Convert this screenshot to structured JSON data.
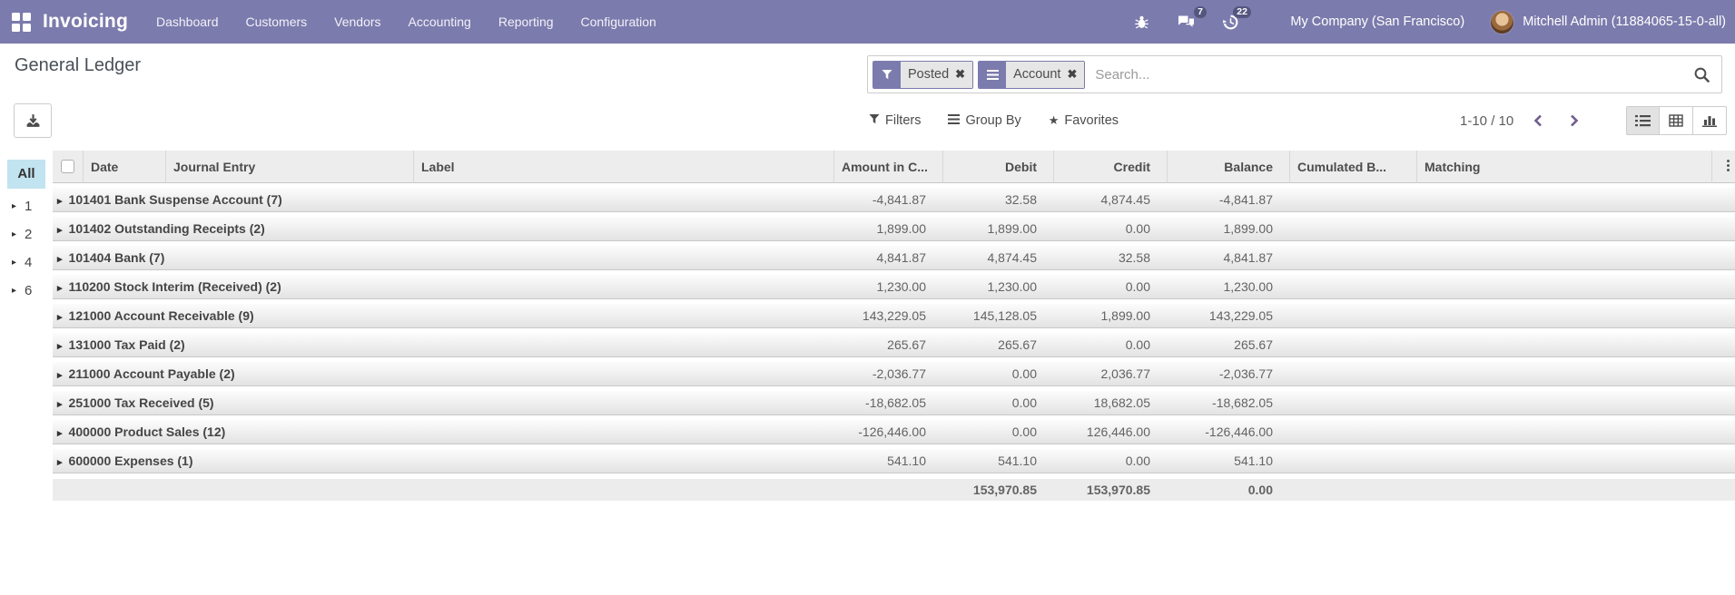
{
  "nav": {
    "app_name": "Invoicing",
    "menus": [
      "Dashboard",
      "Customers",
      "Vendors",
      "Accounting",
      "Reporting",
      "Configuration"
    ],
    "systray": {
      "messages_count": "7",
      "activities_count": "22",
      "company": "My Company (San Francisco)",
      "user": "Mitchell Admin (11884065-15-0-all)"
    }
  },
  "page": {
    "title": "General Ledger"
  },
  "search": {
    "facets": [
      {
        "icon": "filter-icon",
        "label": "Posted"
      },
      {
        "icon": "group-by-icon",
        "label": "Account"
      }
    ],
    "placeholder": "Search..."
  },
  "controls": {
    "filters": "Filters",
    "group_by": "Group By",
    "favorites": "Favorites",
    "pager": "1-10 / 10"
  },
  "sidebar": {
    "all_label": "All",
    "items": [
      "1",
      "2",
      "4",
      "6"
    ]
  },
  "table": {
    "headers": [
      "Date",
      "Journal Entry",
      "Label",
      "Amount in C...",
      "Debit",
      "Credit",
      "Balance",
      "Cumulated B...",
      "Matching"
    ],
    "groups": [
      {
        "name": "101401 Bank Suspense Account (7)",
        "amount_currency": "-4,841.87",
        "debit": "32.58",
        "credit": "4,874.45",
        "balance": "-4,841.87"
      },
      {
        "name": "101402 Outstanding Receipts (2)",
        "amount_currency": "1,899.00",
        "debit": "1,899.00",
        "credit": "0.00",
        "balance": "1,899.00"
      },
      {
        "name": "101404 Bank (7)",
        "amount_currency": "4,841.87",
        "debit": "4,874.45",
        "credit": "32.58",
        "balance": "4,841.87"
      },
      {
        "name": "110200 Stock Interim (Received) (2)",
        "amount_currency": "1,230.00",
        "debit": "1,230.00",
        "credit": "0.00",
        "balance": "1,230.00"
      },
      {
        "name": "121000 Account Receivable (9)",
        "amount_currency": "143,229.05",
        "debit": "145,128.05",
        "credit": "1,899.00",
        "balance": "143,229.05"
      },
      {
        "name": "131000 Tax Paid (2)",
        "amount_currency": "265.67",
        "debit": "265.67",
        "credit": "0.00",
        "balance": "265.67"
      },
      {
        "name": "211000 Account Payable (2)",
        "amount_currency": "-2,036.77",
        "debit": "0.00",
        "credit": "2,036.77",
        "balance": "-2,036.77"
      },
      {
        "name": "251000 Tax Received (5)",
        "amount_currency": "-18,682.05",
        "debit": "0.00",
        "credit": "18,682.05",
        "balance": "-18,682.05"
      },
      {
        "name": "400000 Product Sales (12)",
        "amount_currency": "-126,446.00",
        "debit": "0.00",
        "credit": "126,446.00",
        "balance": "-126,446.00"
      },
      {
        "name": "600000 Expenses (1)",
        "amount_currency": "541.10",
        "debit": "541.10",
        "credit": "0.00",
        "balance": "541.10"
      }
    ],
    "footer": {
      "debit": "153,970.85",
      "credit": "153,970.85",
      "balance": "0.00"
    }
  },
  "glyphs": {
    "caret": "▸",
    "star": "★",
    "remove": "✖"
  },
  "colors": {
    "navbar": "#7c7bad",
    "all_tab": "#c2e3f0",
    "header_bg": "#ededed"
  }
}
